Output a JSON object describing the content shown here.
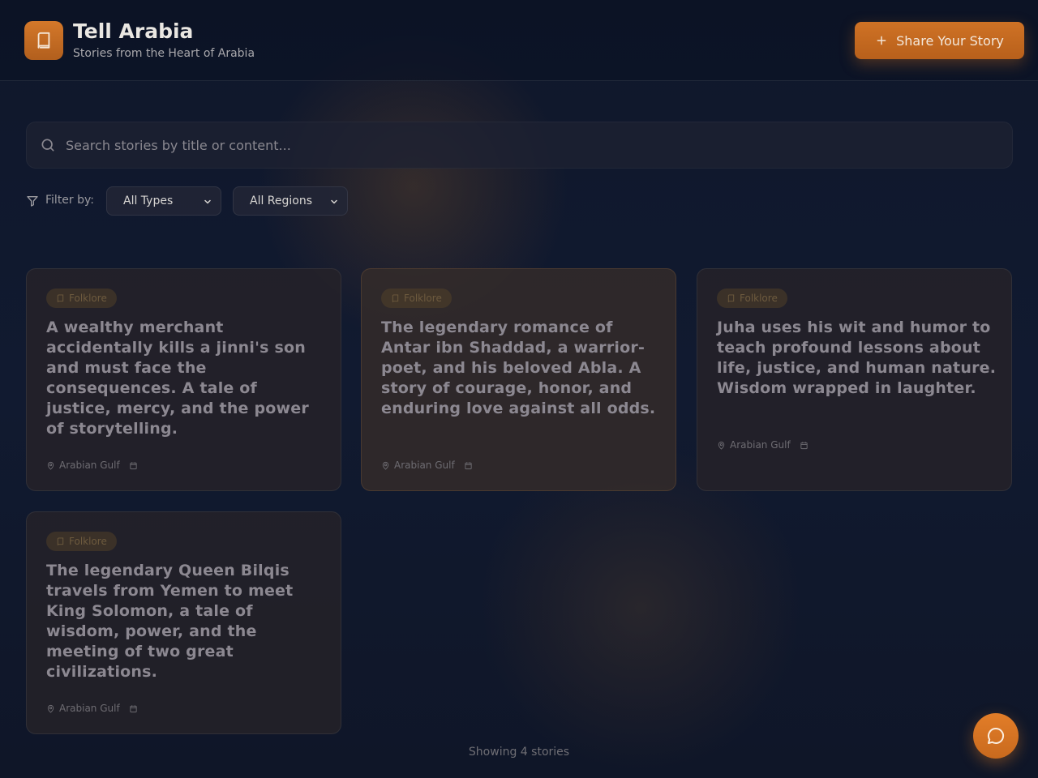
{
  "header": {
    "title": "Tell Arabia",
    "subtitle": "Stories from the Heart of Arabia",
    "share_label": "Share Your Story",
    "logo_icon": "book-icon"
  },
  "search": {
    "placeholder": "Search stories by title or content..."
  },
  "filters": {
    "label": "Filter by:",
    "type_selected": "All Types",
    "region_selected": "All Regions"
  },
  "stories": [
    {
      "type": "Folklore",
      "text": "A wealthy merchant accidentally kills a jinni's son and must face the consequences. A tale of justice, mercy, and the power of storytelling.",
      "region": "Arabian Gulf"
    },
    {
      "type": "Folklore",
      "text": "The legendary romance of Antar ibn Shaddad, a warrior-poet, and his beloved Abla. A story of courage, honor, and enduring love against all odds.",
      "region": "Arabian Gulf"
    },
    {
      "type": "Folklore",
      "text": "Juha uses his wit and humor to teach profound lessons about life, justice, and human nature. Wisdom wrapped in laughter.",
      "region": "Arabian Gulf"
    },
    {
      "type": "Folklore",
      "text": "The legendary Queen Bilqis travels from Yemen to meet King Solomon, a tale of wisdom, power, and the meeting of two great civilizations.",
      "region": "Arabian Gulf"
    }
  ],
  "footer": {
    "count_text": "Showing 4 stories"
  },
  "colors": {
    "accent": "#cf7225",
    "background": "#0f1628"
  }
}
